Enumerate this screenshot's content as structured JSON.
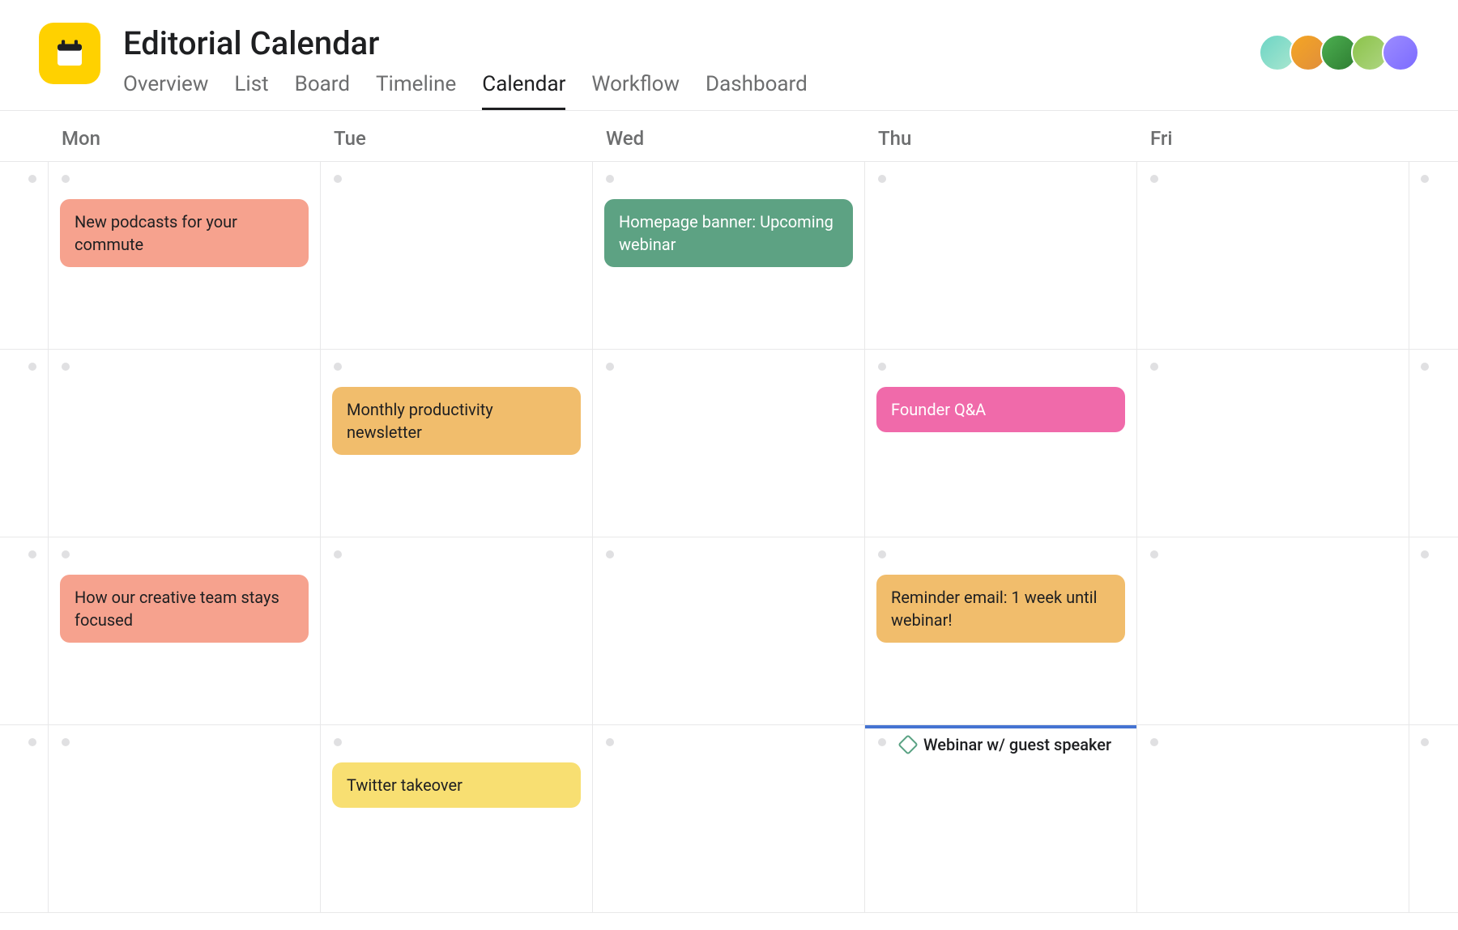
{
  "project": {
    "title": "Editorial Calendar"
  },
  "tabs": {
    "overview": "Overview",
    "list": "List",
    "board": "Board",
    "timeline": "Timeline",
    "calendar": "Calendar",
    "workflow": "Workflow",
    "dashboard": "Dashboard"
  },
  "days": {
    "mon": "Mon",
    "tue": "Tue",
    "wed": "Wed",
    "thu": "Thu",
    "fri": "Fri"
  },
  "tasks": {
    "w1_mon": "New podcasts for your commute",
    "w1_wed": "Homepage banner: Upcoming webinar",
    "w2_tue": "Monthly productivity newsletter",
    "w2_thu": "Founder Q&A",
    "w3_mon": "How our creative team stays focused",
    "w3_thu": "Reminder email: 1 week until webinar!",
    "w4_tue": "Twitter takeover",
    "w4_thu_event": "Webinar w/ guest speaker"
  },
  "colors": {
    "coral": "#f6a28e",
    "green": "#5da283",
    "orange": "#f1bd6c",
    "pink": "#f06aaa",
    "yellow": "#f8df72",
    "accent_blue": "#4573d2",
    "icon_yellow": "#ffd100"
  }
}
